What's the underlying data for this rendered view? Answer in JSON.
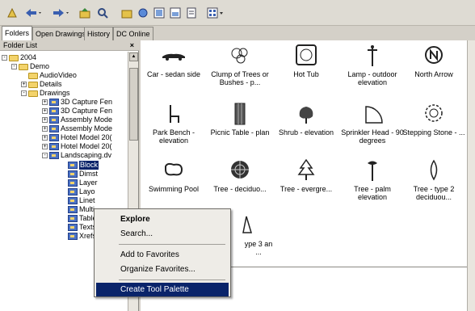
{
  "tabs": [
    {
      "label": "Folders"
    },
    {
      "label": "Open Drawings"
    },
    {
      "label": "History"
    },
    {
      "label": "DC Online"
    }
  ],
  "left_panel": {
    "title": "Folder List",
    "close_label": "×",
    "tree": [
      {
        "label": "2004",
        "expander": "-"
      },
      {
        "label": "Demo",
        "expander": "-"
      },
      {
        "label": "AudioVideo",
        "expander": ""
      },
      {
        "label": "Details",
        "expander": "+"
      },
      {
        "label": "Drawings",
        "expander": "-"
      },
      {
        "label": "3D Capture Fen",
        "expander": "+"
      },
      {
        "label": "3D Capture Fen",
        "expander": "+"
      },
      {
        "label": "Assembly Mode",
        "expander": "+"
      },
      {
        "label": "Assembly Mode",
        "expander": "+"
      },
      {
        "label": "Hotel Model 20(",
        "expander": "+"
      },
      {
        "label": "Hotel Model 20(",
        "expander": "+"
      },
      {
        "label": "Landscaping.dv",
        "expander": "-"
      },
      {
        "label": "Block",
        "expander": ""
      },
      {
        "label": "Dimst",
        "expander": ""
      },
      {
        "label": "Layer",
        "expander": ""
      },
      {
        "label": "Layo",
        "expander": ""
      },
      {
        "label": "Linet",
        "expander": ""
      },
      {
        "label": "Multi",
        "expander": ""
      },
      {
        "label": "Table",
        "expander": ""
      },
      {
        "label": "Texts",
        "expander": ""
      },
      {
        "label": "Xrefs",
        "expander": ""
      }
    ]
  },
  "content_items": [
    {
      "label": "Car - sedan side",
      "icon": "car-icon"
    },
    {
      "label": "Clump of Trees or Bushes - p...",
      "icon": "tree-clump-icon"
    },
    {
      "label": "Hot Tub",
      "icon": "hot-tub-icon"
    },
    {
      "label": "Lamp - outdoor elevation",
      "icon": "lamp-icon"
    },
    {
      "label": "North Arrow",
      "icon": "north-arrow-icon"
    },
    {
      "label": "Park Bench - elevation",
      "icon": "bench-icon"
    },
    {
      "label": "Picnic Table - plan",
      "icon": "picnic-table-icon"
    },
    {
      "label": "Shrub - elevation",
      "icon": "shrub-icon"
    },
    {
      "label": "Sprinkler Head - 90 degrees",
      "icon": "sprinkler-icon"
    },
    {
      "label": "Stepping Stone - ...",
      "icon": "stepping-stone-icon"
    },
    {
      "label": "Swimming Pool",
      "icon": "pool-icon"
    },
    {
      "label": "Tree - deciduo...",
      "icon": "tree-deciduous-icon"
    },
    {
      "label": "Tree - evergre...",
      "icon": "tree-evergreen-icon"
    },
    {
      "label": "Tree - palm elevation",
      "icon": "palm-icon"
    },
    {
      "label": "Tree - type 2 deciduou...",
      "icon": "tree-type2-icon"
    },
    {
      "label": "ype 3 an ...",
      "icon": "tree-type3-icon"
    }
  ],
  "context_menu": {
    "explore": "Explore",
    "search": "Search...",
    "add_favorites": "Add to Favorites",
    "organize_favorites": "Organize Favorites...",
    "create_palette": "Create Tool Palette"
  }
}
